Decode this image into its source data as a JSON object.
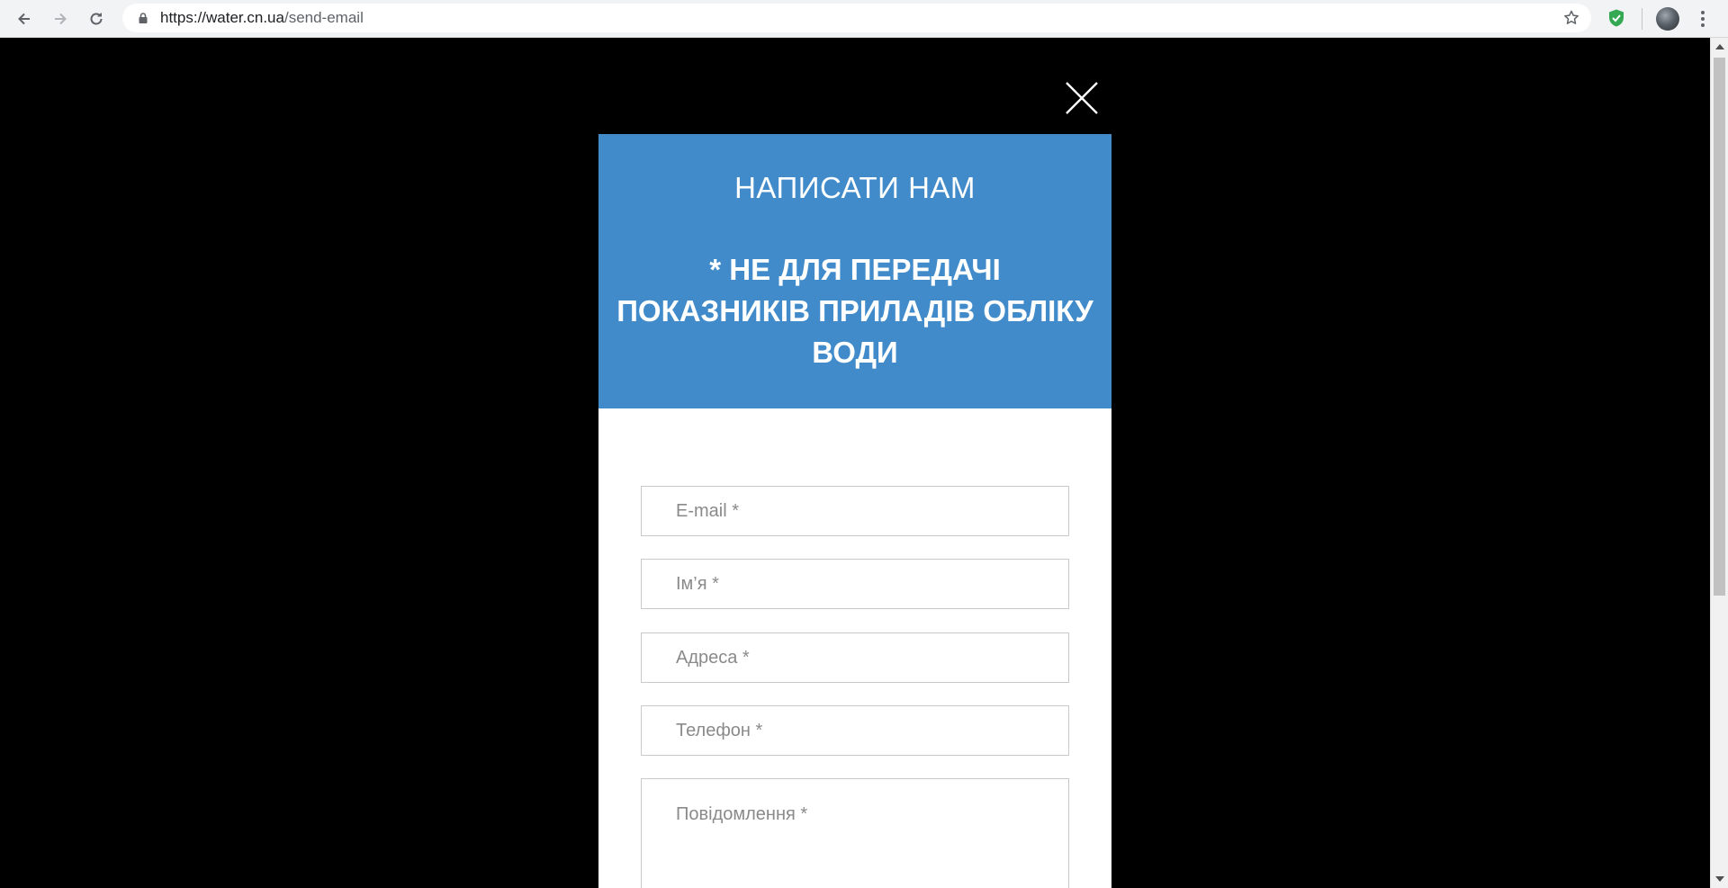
{
  "browser": {
    "url_host": "https://water.cn.ua",
    "url_path": "/send-email",
    "icons": [
      "back-icon",
      "forward-icon",
      "reload-icon",
      "lock-icon",
      "star-icon",
      "shield-extension-icon",
      "profile-avatar",
      "menu-icon"
    ]
  },
  "modal": {
    "title": "НАПИСАТИ НАМ",
    "subtitle": "* НЕ ДЛЯ ПЕРЕДАЧІ ПОКАЗНИКІВ ПРИЛАДІВ ОБЛІКУ ВОДИ",
    "close_icon": "close-icon",
    "fields": {
      "email_placeholder": "E-mail *",
      "name_placeholder": "Ім’я *",
      "address_placeholder": "Адреса *",
      "phone_placeholder": "Телефон *",
      "message_placeholder": "Повідомлення *"
    }
  },
  "colors": {
    "header_bg": "#418bca",
    "overlay_bg": "#000000",
    "modal_bg": "#ffffff"
  }
}
